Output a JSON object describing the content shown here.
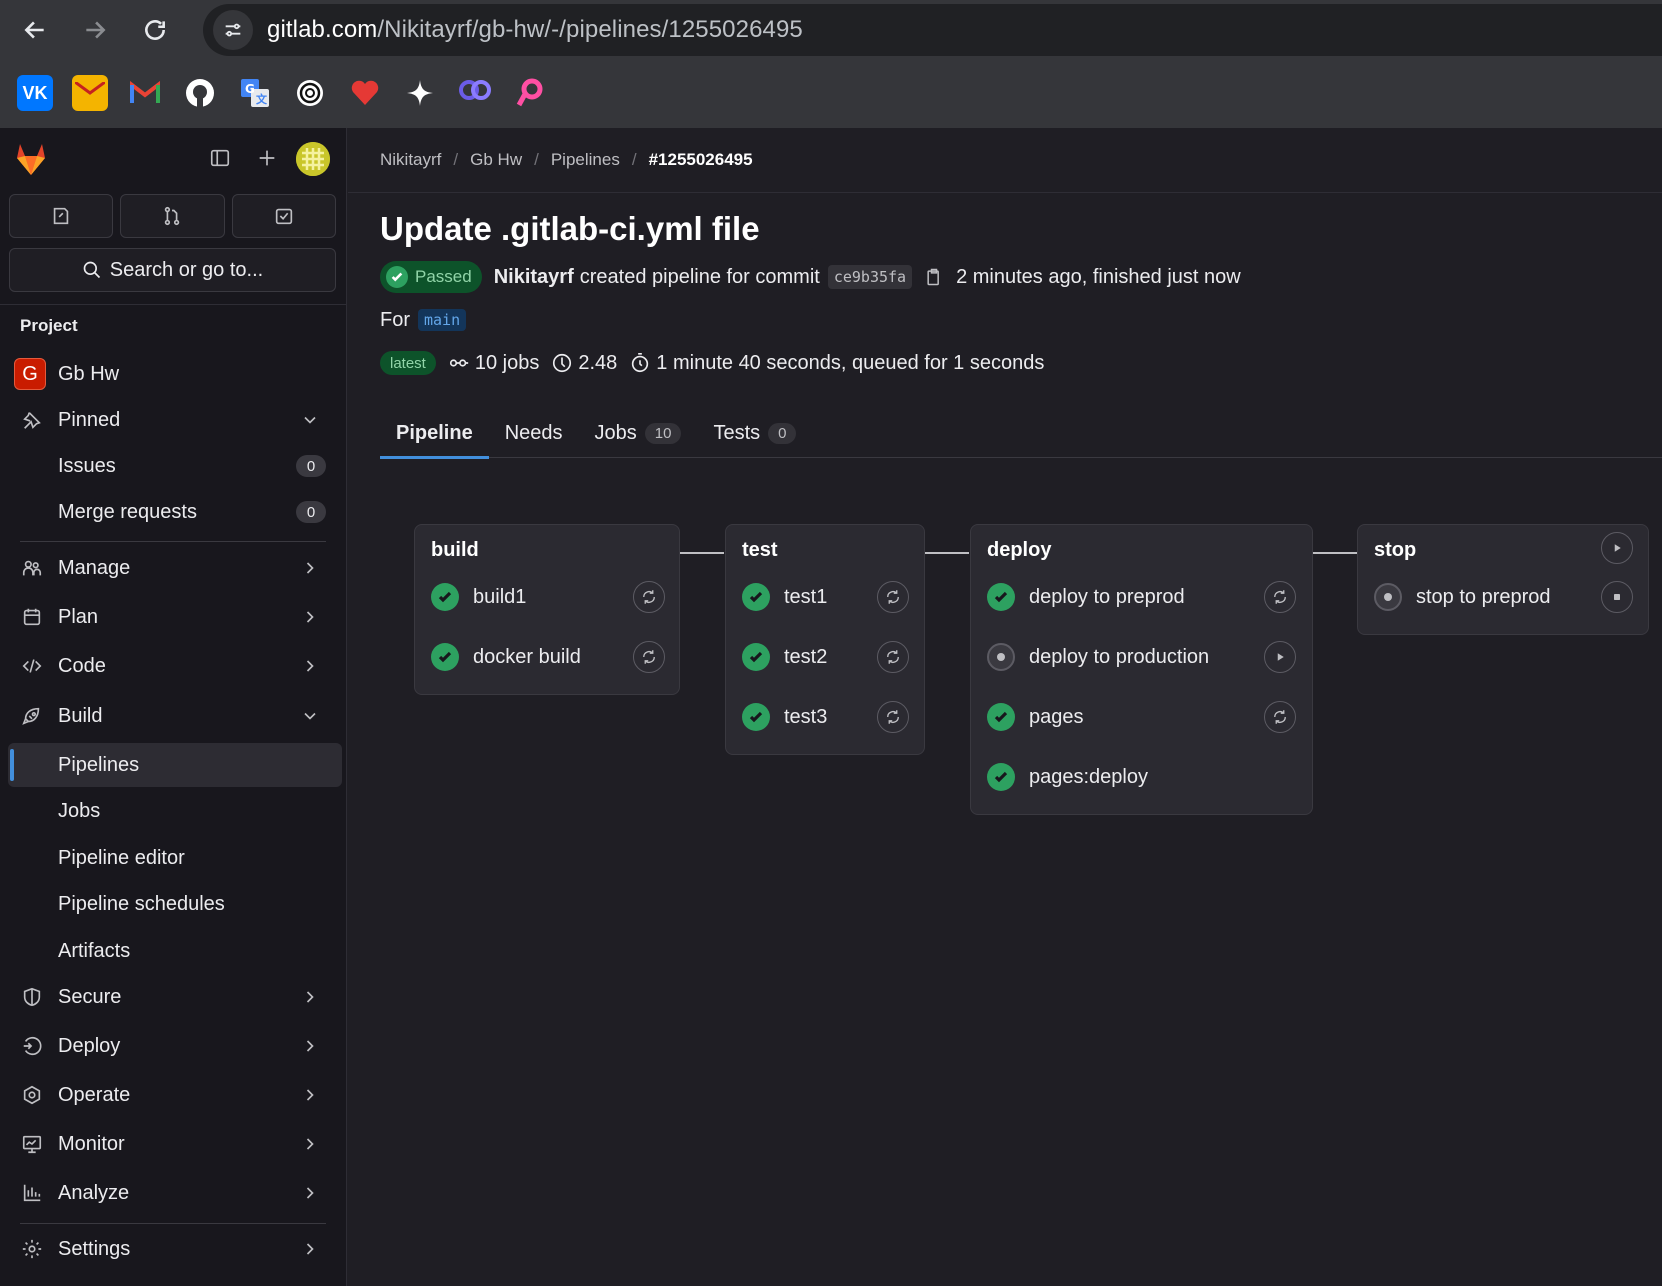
{
  "browser": {
    "url_host": "gitlab.com",
    "url_path": "/Nikitayrf/gb-hw/-/pipelines/1255026495",
    "bookmarks": [
      "vk-icon",
      "mail-icon",
      "gmail-icon",
      "github-icon",
      "translate-icon",
      "openai-icon",
      "heart-icon",
      "sparkle-icon",
      "ghost-icon",
      "pin-icon"
    ]
  },
  "sidebar": {
    "search_label": "Search or go to...",
    "section_label": "Project",
    "project_initial": "G",
    "project_name": "Gb Hw",
    "pinned": "Pinned",
    "issues": "Issues",
    "issues_count": "0",
    "merge_requests": "Merge requests",
    "merge_requests_count": "0",
    "manage": "Manage",
    "plan": "Plan",
    "code": "Code",
    "build": "Build",
    "pipelines": "Pipelines",
    "jobs": "Jobs",
    "pipeline_editor": "Pipeline editor",
    "pipeline_schedules": "Pipeline schedules",
    "artifacts": "Artifacts",
    "secure": "Secure",
    "deploy": "Deploy",
    "operate": "Operate",
    "monitor": "Monitor",
    "analyze": "Analyze",
    "settings": "Settings"
  },
  "breadcrumb": [
    "Nikitayrf",
    "Gb Hw",
    "Pipelines",
    "#1255026495"
  ],
  "pipeline": {
    "title": "Update .gitlab-ci.yml file",
    "status": "Passed",
    "author": "Nikitayrf",
    "created_text": "created pipeline for commit",
    "sha": "ce9b35fa",
    "time_text": "2 minutes ago, finished just now",
    "for_label": "For",
    "ref": "main",
    "latest": "latest",
    "jobs_count": "10 jobs",
    "compute": "2.48",
    "duration": "1 minute 40 seconds, queued for 1 seconds"
  },
  "tabs": {
    "pipeline": "Pipeline",
    "needs": "Needs",
    "jobs": "Jobs",
    "jobs_count": "10",
    "tests": "Tests",
    "tests_count": "0"
  },
  "stages": {
    "build": {
      "name": "build",
      "jobs": [
        "build1",
        "docker build"
      ]
    },
    "test": {
      "name": "test",
      "jobs": [
        "test1",
        "test2",
        "test3"
      ]
    },
    "deploy": {
      "name": "deploy",
      "jobs": [
        "deploy to preprod",
        "deploy to production",
        "pages",
        "pages:deploy"
      ]
    },
    "stop": {
      "name": "stop",
      "jobs": [
        "stop to preprod"
      ]
    }
  },
  "colors": {
    "accent": "#428fdc",
    "success": "#2da160",
    "bg": "#1f1e24",
    "sidebar": "#18171d"
  }
}
